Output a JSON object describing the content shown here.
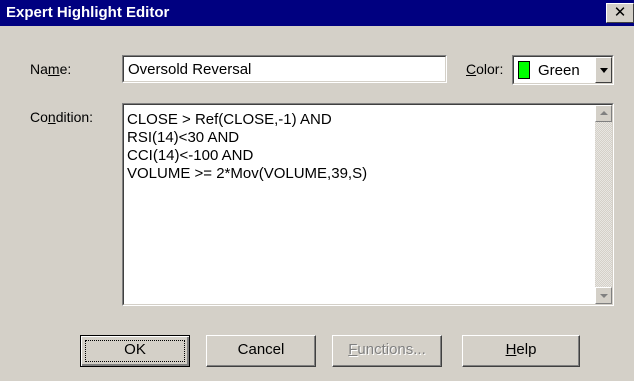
{
  "window": {
    "title": "Expert Highlight Editor",
    "close_glyph": "✕"
  },
  "name_label": {
    "pre": "Na",
    "accel": "m",
    "post": "e:"
  },
  "name_value": "Oversold Reversal",
  "color_label": {
    "accel": "C",
    "post": "olor:"
  },
  "color": {
    "value": "Green",
    "swatch_hex": "#00ff00"
  },
  "condition_label": {
    "pre": "Co",
    "accel": "n",
    "post": "dition:"
  },
  "condition_text": "CLOSE > Ref(CLOSE,-1) AND\nRSI(14)<30 AND\nCCI(14)<-100 AND\nVOLUME >= 2*Mov(VOLUME,39,S)",
  "buttons": {
    "ok": "OK",
    "cancel": "Cancel",
    "functions": {
      "accel": "F",
      "post": "unctions..."
    },
    "help": {
      "accel": "H",
      "post": "elp"
    }
  },
  "icons": {
    "close": "close-icon",
    "dropdown": "chevron-down-icon",
    "scroll_up": "scroll-up-arrow-icon",
    "scroll_down": "scroll-down-arrow-icon"
  },
  "colors": {
    "title_bar": "#000080",
    "face": "#d4d0c8"
  }
}
